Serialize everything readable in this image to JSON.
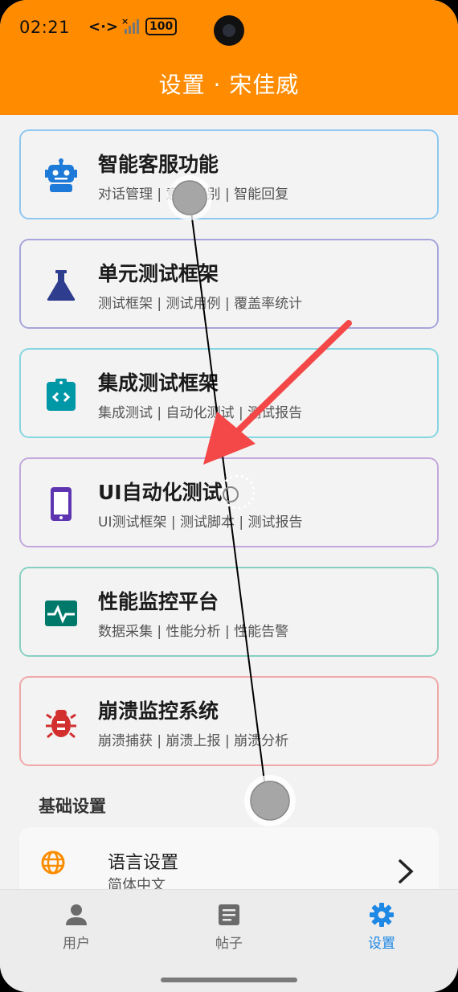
{
  "status": {
    "time": "02:21",
    "code_icon": "<·>",
    "battery": "100"
  },
  "appbar": {
    "title": "设置 · 宋佳威"
  },
  "cards": [
    {
      "title": "智能客服功能",
      "sub": "对话管理 | 意图识别 | 智能回复",
      "icon": "robot-icon",
      "border": "#8ec8f0",
      "color": "#1e7ad8"
    },
    {
      "title": "单元测试框架",
      "sub": "测试框架 | 测试用例 | 覆盖率统计",
      "icon": "flask-icon",
      "border": "#a7a5dc",
      "color": "#2f3d8f"
    },
    {
      "title": "集成测试框架",
      "sub": "集成测试 | 自动化测试 | 测试报告",
      "icon": "integration-icon",
      "border": "#86d6e2",
      "color": "#0097a7"
    },
    {
      "title": "UI自动化测试",
      "sub": "UI测试框架 | 测试脚本 | 测试报告",
      "icon": "phone-icon",
      "border": "#c2a8dc",
      "color": "#5e35b1"
    },
    {
      "title": "性能监控平台",
      "sub": "数据采集 | 性能分析 | 性能告警",
      "icon": "monitor-icon",
      "border": "#88d0c2",
      "color": "#00796b"
    },
    {
      "title": "崩溃监控系统",
      "sub": "崩溃捕获 | 崩溃上报 | 崩溃分析",
      "icon": "bug-icon",
      "border": "#f0a8a8",
      "color": "#d32f2f"
    }
  ],
  "section": {
    "title": "基础设置"
  },
  "language": {
    "label": "语言设置",
    "value": "简体中文",
    "icon": "globe-icon",
    "color": "#fb8c00"
  },
  "nav": [
    {
      "label": "用户",
      "icon": "person-icon"
    },
    {
      "label": "帖子",
      "icon": "article-icon"
    },
    {
      "label": "设置",
      "icon": "gear-icon",
      "active": true
    }
  ],
  "colors": {
    "appbar": "#ff8c00",
    "active": "#1e88e5",
    "arrow": "#f44848"
  }
}
